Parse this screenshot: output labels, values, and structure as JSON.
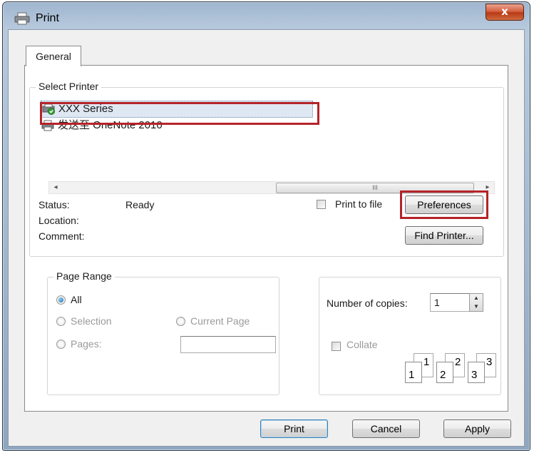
{
  "window": {
    "title": "Print",
    "close_glyph": "x"
  },
  "tabs": [
    {
      "label": "General"
    }
  ],
  "select_printer": {
    "legend": "Select Printer",
    "printers": [
      {
        "name": "XXX Series",
        "selected": true,
        "icon": "printer-default-icon"
      },
      {
        "name": "发送至 OneNote 2010",
        "selected": false,
        "icon": "printer-icon"
      }
    ],
    "scroll_left": "◂",
    "scroll_right": "▸",
    "scroll_grip": "III",
    "status_label": "Status:",
    "status_value": "Ready",
    "location_label": "Location:",
    "comment_label": "Comment:",
    "print_to_file_label": "Print to file",
    "preferences_label": "Preferences",
    "find_printer_label": "Find Printer...",
    "highlight_color": "#b5232a"
  },
  "page_range": {
    "legend": "Page Range",
    "all_label": "All",
    "selection_label": "Selection",
    "current_page_label": "Current Page",
    "pages_label": "Pages:",
    "pages_value": ""
  },
  "copies": {
    "label": "Number of copies:",
    "value": "1",
    "collate_label": "Collate",
    "collate_pages": [
      "1",
      "1",
      "2",
      "2",
      "3",
      "3"
    ]
  },
  "buttons": {
    "print": "Print",
    "cancel": "Cancel",
    "apply": "Apply"
  }
}
